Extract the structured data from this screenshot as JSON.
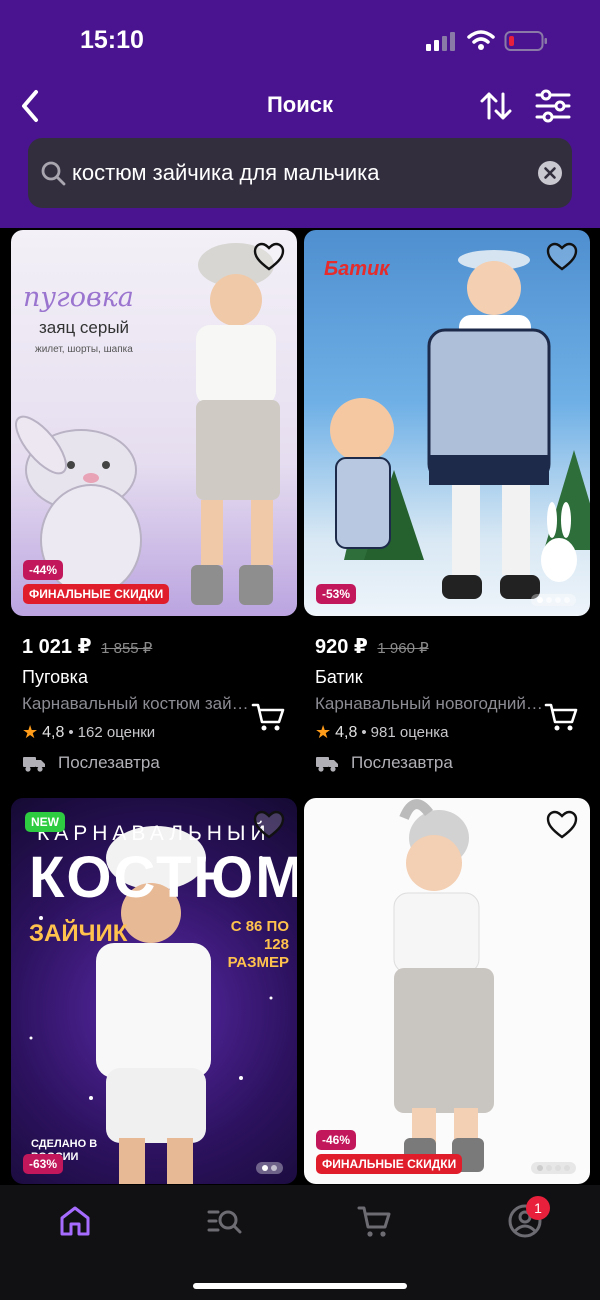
{
  "status_bar": {
    "time": "15:10",
    "icons": [
      "cellular-signal-icon",
      "wifi-icon",
      "battery-low-icon"
    ]
  },
  "header": {
    "title": "Поиск",
    "back_icon": "chevron-left-icon",
    "sort_icon": "sort-arrows-icon",
    "filter_icon": "filter-sliders-icon"
  },
  "search": {
    "value": "костюм зайчика для мальчика",
    "icon": "search-icon",
    "clear_icon": "clear-x-icon"
  },
  "products": [
    {
      "price": "1 021 ₽",
      "old_price": "1 855 ₽",
      "brand": "Пуговка",
      "description": "Карнавальный костюм зайчика",
      "rating": "4,8",
      "reviews": "162 оценки",
      "delivery": "Послезавтра",
      "discount": "-44%",
      "promo": "ФИНАЛЬНЫЕ СКИДКИ",
      "image_text": {
        "brand": "пуговка",
        "title": "заяц серый",
        "subtitle": "жилет, шорты, шапка"
      }
    },
    {
      "price": "920 ₽",
      "old_price": "1 960 ₽",
      "brand": "Батик",
      "description": "Карнавальный новогодний костюм",
      "rating": "4,8",
      "reviews": "981 оценка",
      "delivery": "Послезавтра",
      "discount": "-53%",
      "image_text": {
        "brand": "Батик"
      }
    },
    {
      "badge_new": "NEW",
      "discount": "-63%",
      "image_text": {
        "line1": "КАРНАВАЛЬНЫЙ",
        "line2": "КОСТЮМ",
        "line3": "ЗАЙЧИК",
        "size": "С 86 ПО 128 РАЗМЕР",
        "made": "СДЕЛАНО В РОССИИ"
      }
    },
    {
      "discount": "-46%",
      "promo": "ФИНАЛЬНЫЕ СКИДКИ"
    }
  ],
  "tabbar": {
    "tabs": [
      "home-icon",
      "catalog-search-icon",
      "cart-icon",
      "profile-icon"
    ],
    "profile_badge": "1"
  },
  "colors": {
    "header": "#4a1390",
    "accent": "#a66cff",
    "discount": "#c2185b",
    "promo": "#e01e2b"
  }
}
